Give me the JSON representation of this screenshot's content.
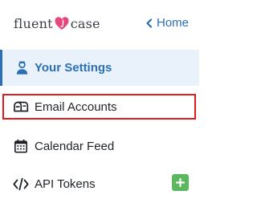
{
  "brand": {
    "logo_text_left": "fluent",
    "logo_text_right": "case",
    "heart_color": "#e8457a"
  },
  "header": {
    "home_label": "Home"
  },
  "nav": {
    "items": [
      {
        "label": "Your Settings",
        "icon": "user-settings-icon",
        "active": true
      },
      {
        "label": "Email Accounts",
        "icon": "mailbox-icon",
        "highlighted": true
      },
      {
        "label": "Calendar Feed",
        "icon": "calendar-icon"
      },
      {
        "label": "API Tokens",
        "icon": "code-icon",
        "action": "add-icon"
      }
    ]
  },
  "colors": {
    "accent": "#2b6fb6",
    "active_bg": "#e9f2fb",
    "highlight_border": "#e01b1b",
    "add_button": "#5cb85c"
  }
}
